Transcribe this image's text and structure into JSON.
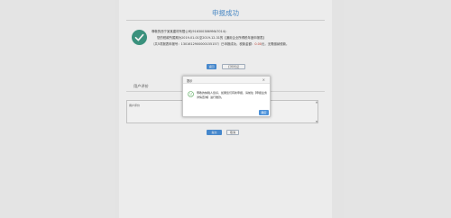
{
  "page": {
    "title": "申报成功"
  },
  "result": {
    "line1": "尊敬的西宁某某建材有限公司(9163003869MA7014)：",
    "line2": "您的税款所属期为2019-01-01至2019-12-31的【通用企业所得税年度申报表】",
    "line3_prefix": "（共5项报表申报号：1301612900000155157）已申报成功，税款金额：",
    "line3_amount": "0.00",
    "line3_suffix": "元，无需缴纳税款。",
    "colors": {
      "success": "#3e9b85",
      "accent": "#4a90d9",
      "highlight": "#c0392b"
    }
  },
  "actions": {
    "back_label": "返回",
    "print_label": "打印凭证"
  },
  "feedback": {
    "section_title": "用户评价",
    "comment_label": "用户评价",
    "submit_label": "提交",
    "cancel_label": "取消"
  },
  "dialog": {
    "title": "提示",
    "close_glyph": "×",
    "message": "尊敬的纳税人您好，如果您们有新申报，请前往【申报业务详情查询】进行缴款。",
    "ok_label": "确定",
    "icon": "smile-icon"
  }
}
